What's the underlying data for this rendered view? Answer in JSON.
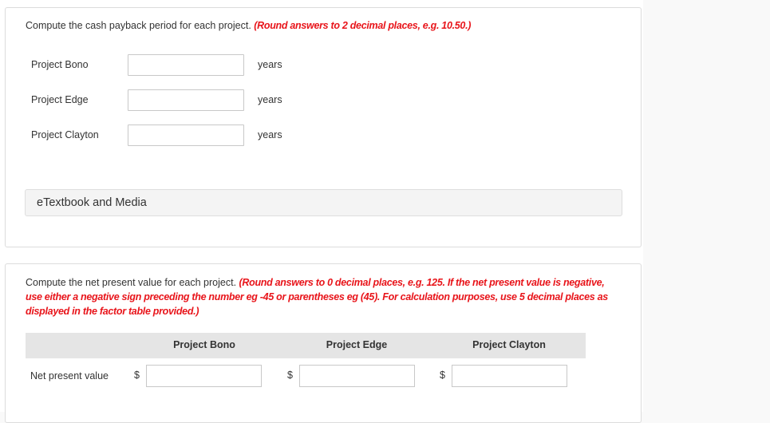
{
  "payback": {
    "instruction": "Compute the cash payback period for each project.",
    "instruction_note": "(Round answers to 2 decimal places, e.g. 10.50.)",
    "rows": [
      {
        "label": "Project Bono",
        "value": "",
        "unit": "years"
      },
      {
        "label": "Project Edge",
        "value": "",
        "unit": "years"
      },
      {
        "label": "Project Clayton",
        "value": "",
        "unit": "years"
      }
    ],
    "etextbook_label": "eTextbook and Media"
  },
  "npv": {
    "instruction": "Compute the net present value for each project.",
    "instruction_note": "(Round answers to 0 decimal places, e.g. 125. If the net present value is negative, use either a negative sign preceding the number eg -45 or parentheses eg (45). For calculation purposes, use 5 decimal places as displayed in the factor table provided.)",
    "columns": [
      "Project Bono",
      "Project Edge",
      "Project Clayton"
    ],
    "row_label": "Net present value",
    "currency_symbol": "$",
    "values": [
      "",
      "",
      ""
    ]
  },
  "colors": {
    "instruction_note": "#e8141a",
    "header_band": "#e5e5e5"
  }
}
